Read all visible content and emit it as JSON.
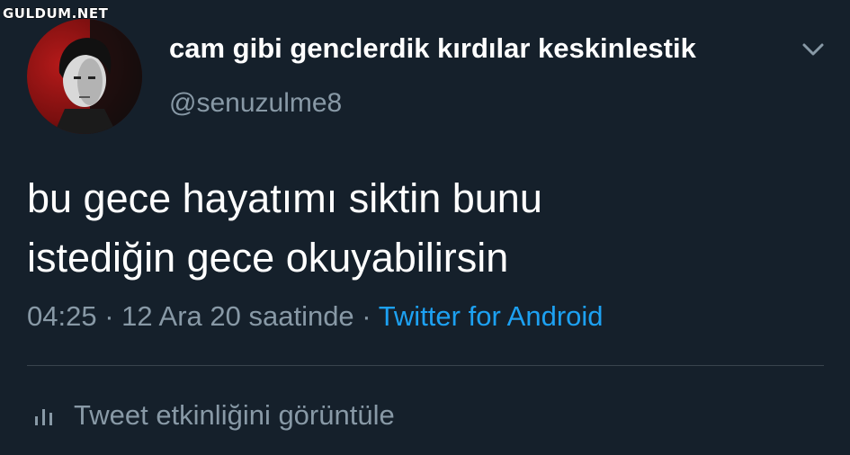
{
  "watermark": "GULDUM.NET",
  "author": {
    "display_name": "cam gibi genclerdik kırdılar keskinlestik",
    "username": "@senuzulme8",
    "avatar_icon": "profile-photo"
  },
  "tweet": {
    "text_lines": [
      "bu gece hayatımı siktin bunu",
      "istediğin gece okuyabilirsin"
    ]
  },
  "meta": {
    "time": "04:25",
    "sep1": " · ",
    "date": "12 Ara 20 saatinde",
    "sep2": " · ",
    "source": "Twitter for Android"
  },
  "actions": {
    "activity_label": "Tweet etkinliğini görüntüle",
    "activity_icon": "bar-chart-icon",
    "more_icon": "chevron-down-icon"
  },
  "colors": {
    "background": "#15202b",
    "secondary_text": "#8899a6",
    "link": "#1da1f2",
    "divider": "#38444d"
  }
}
